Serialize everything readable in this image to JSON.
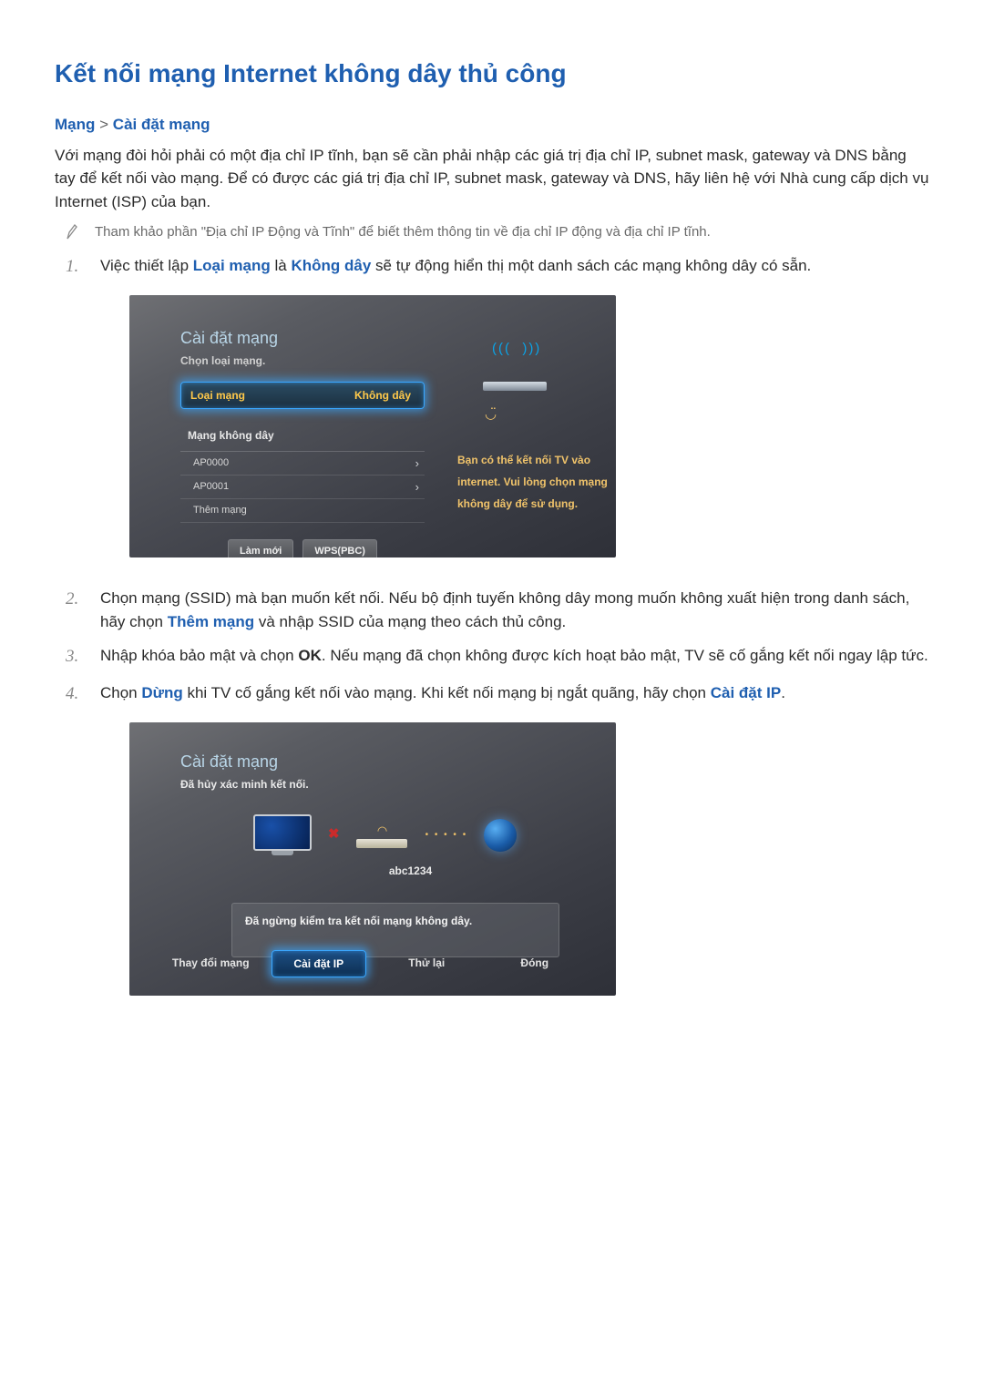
{
  "page": {
    "title": "Kết nối mạng Internet không dây thủ công"
  },
  "breadcrumb": {
    "a": "Mạng",
    "sep": ">",
    "b": "Cài đặt mạng"
  },
  "intro": "Với mạng đòi hỏi phải có một địa chỉ IP tĩnh, bạn sẽ cần phải nhập các giá trị địa chỉ IP, subnet mask, gateway và DNS bằng tay để kết nối vào mạng. Để có được các giá trị địa chỉ IP, subnet mask, gateway và DNS, hãy liên hệ với Nhà cung cấp dịch vụ Internet (ISP) của bạn.",
  "note": "Tham khảo phần \"Địa chỉ IP Động và Tĩnh\" để biết thêm thông tin về địa chỉ IP động và địa chỉ IP tĩnh.",
  "steps": {
    "s1": {
      "pre": "Việc thiết lập ",
      "kw1": "Loại mạng",
      "mid": " là ",
      "kw2": "Không dây",
      "post": " sẽ tự động hiển thị một danh sách các mạng không dây có sẵn."
    },
    "s2": {
      "pre": "Chọn mạng (SSID) mà bạn muốn kết nối. Nếu bộ định tuyến không dây mong muốn không xuất hiện trong danh sách, hãy chọn ",
      "kw": "Thêm mạng",
      "post": " và nhập SSID của mạng theo cách thủ công."
    },
    "s3": {
      "pre": "Nhập khóa bảo mật và chọn ",
      "kw": "OK",
      "post": ". Nếu mạng đã chọn không được kích hoạt bảo mật, TV sẽ cố gắng kết nối ngay lập tức."
    },
    "s4": {
      "pre": "Chọn ",
      "kw1": "Dừng",
      "mid": " khi TV cố gắng kết nối vào mạng. Khi kết nối mạng bị ngắt quãng, hãy chọn ",
      "kw2": "Cài đặt IP",
      "post": "."
    }
  },
  "tv1": {
    "title": "Cài đặt mạng",
    "subtitle": "Chọn loại mạng.",
    "field_label": "Loại mạng",
    "field_value": "Không dây",
    "section": "Mạng không dây",
    "nets": [
      "AP0000",
      "AP0001"
    ],
    "add_net": "Thêm mạng",
    "refresh": "Làm mới",
    "wps": "WPS(PBC)",
    "info1": "Bạn có thể kết nối TV vào",
    "info2": "internet. Vui lòng chọn mạng",
    "info3": "không dây để sử dụng."
  },
  "tv2": {
    "title": "Cài đặt mạng",
    "subtitle": "Đã hủy xác minh kết nối.",
    "net_name": "abc1234",
    "message": "Đã ngừng kiểm tra kết nối mạng không dây.",
    "btn_change": "Thay đổi mạng",
    "btn_ip": "Cài đặt IP",
    "btn_retry": "Thử lại",
    "btn_close": "Đóng"
  }
}
